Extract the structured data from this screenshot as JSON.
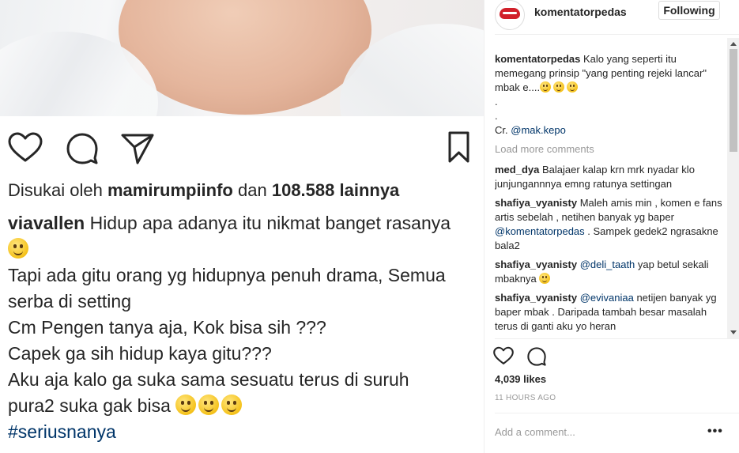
{
  "post": {
    "liked_by_prefix": "Disukai oleh",
    "liked_by_user": "mamirumpiinfo",
    "liked_by_and": "dan",
    "liked_by_others": "108.588 lainnya",
    "caption_user": "viavallen",
    "caption_lines": [
      "Hidup apa adanya itu nikmat banget rasanya",
      "Tapi ada gitu orang yg hidupnya penuh drama, Semua",
      "serba di setting",
      "Cm Pengen tanya aja, Kok bisa sih ???",
      "Capek ga sih hidup kaya gitu???",
      "Aku aja kalo ga suka sama sesuatu terus di suruh",
      "pura2 suka gak bisa"
    ],
    "hashtag": "#seriusnanya"
  },
  "header": {
    "username": "komentatorpedas",
    "follow_label": "Following"
  },
  "comments": {
    "owner": {
      "user": "komentatorpedas",
      "text": "Kalo yang seperti itu memegang prinsip \"yang penting rejeki lancar\" mbak e....",
      "dot1": ".",
      "dot2": ".",
      "credit_prefix": "Cr.",
      "credit_mention": "@mak.kepo"
    },
    "load_more": "Load more comments",
    "items": [
      {
        "user": "med_dya",
        "text": "Balajaer kalap krn mrk nyadar klo junjungannnya emng ratunya settingan"
      },
      {
        "user": "shafiya_vyanisty",
        "text": "Maleh amis min , komen e fans artis sebelah , netihen banyak yg baper",
        "mention": "@komentatorpedas",
        "text2": ". Sampek gedek2 ngrasakne bala2"
      },
      {
        "user": "shafiya_vyanisty",
        "mention": "@deli_taath",
        "text": "yap betul sekali mbaknya"
      },
      {
        "user": "shafiya_vyanisty",
        "mention": "@evivaniaa",
        "text": "netijen banyak yg baper mbak . Daripada tambah besar masalah terus di ganti aku yo heran"
      }
    ]
  },
  "footer": {
    "likes": "4,039 likes",
    "time": "11 HOURS AGO",
    "add_comment_placeholder": "Add a comment...",
    "more": "•••"
  },
  "icons": [
    "heart-icon",
    "comment-icon",
    "share-icon",
    "bookmark-icon",
    "more-options-icon"
  ]
}
